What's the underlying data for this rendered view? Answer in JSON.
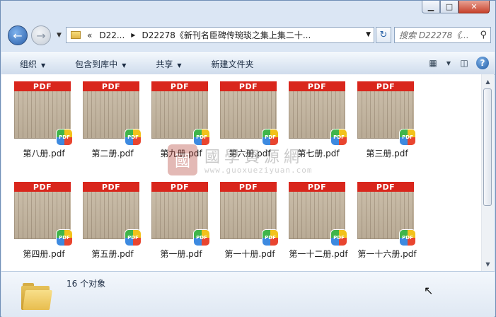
{
  "window": {
    "controls": {
      "minimize": "▁",
      "maximize": "□",
      "close": "✕"
    }
  },
  "address": {
    "breadcrumbs": [
      "«",
      "D22...",
      "D22278《新刊名臣碑传琬琰之集上集二十..."
    ],
    "search_placeholder": "搜索 D22278《...",
    "back_icon": "arrow-left",
    "forward_icon": "arrow-right",
    "refresh_icon": "refresh"
  },
  "toolbar": {
    "organize": "组织",
    "include_in_library": "包含到库中",
    "share": "共享",
    "new_folder": "新建文件夹",
    "help": "?"
  },
  "files": [
    {
      "name": "第八册.pdf"
    },
    {
      "name": "第二册.pdf"
    },
    {
      "name": "第九册.pdf"
    },
    {
      "name": "第六册.pdf"
    },
    {
      "name": "第七册.pdf"
    },
    {
      "name": "第三册.pdf"
    },
    {
      "name": "第四册.pdf"
    },
    {
      "name": "第五册.pdf"
    },
    {
      "name": "第一册.pdf"
    },
    {
      "name": "第一十册.pdf"
    },
    {
      "name": "第一十二册.pdf"
    },
    {
      "name": "第一十六册.pdf"
    }
  ],
  "pdf_band_label": "PDF",
  "badge_label": "PDF",
  "watermark": {
    "seal": "國",
    "title": "國學資源網",
    "url": "www.guoxueziyuan.com"
  },
  "status": {
    "count_text": "16 个对象"
  },
  "colors": {
    "pdf_band": "#d9261c",
    "accent": "#2a63a8"
  }
}
